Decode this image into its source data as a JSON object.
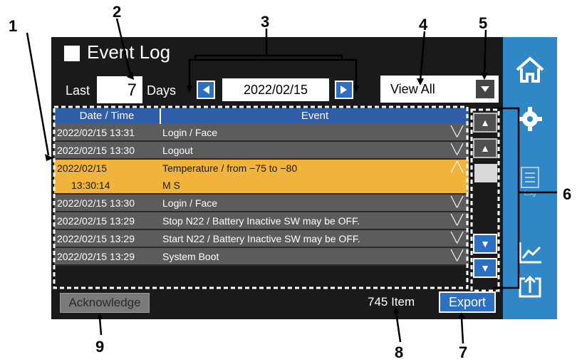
{
  "callouts": [
    "1",
    "2",
    "3",
    "4",
    "5",
    "6",
    "7",
    "8",
    "9"
  ],
  "title": "Event Log",
  "filter": {
    "last_label": "Last",
    "days_value": "7",
    "days_label": "Days",
    "date": "2022/02/15",
    "view_option": "View All"
  },
  "table": {
    "headers": [
      "Date / Time",
      "Event"
    ],
    "rows": [
      {
        "datetime": "2022/02/15 13:31",
        "event": "Login / Face"
      },
      {
        "datetime": "2022/02/15 13:30",
        "event": "Logout"
      },
      {
        "datetime": "2022/02/15",
        "event": "Temperature / from −75 to −80",
        "time": "13:30:14",
        "detail": "M S",
        "selected": true
      },
      {
        "datetime": "2022/02/15 13:30",
        "event": "Login / Face"
      },
      {
        "datetime": "2022/02/15 13:29",
        "event": "Stop N22 / Battery Inactive SW may be OFF."
      },
      {
        "datetime": "2022/02/15 13:29",
        "event": "Start N22 / Battery Inactive SW may be OFF."
      },
      {
        "datetime": "2022/02/15 13:29",
        "event": "System Boot"
      }
    ]
  },
  "footer": {
    "acknowledge_label": "Acknowledge",
    "count": "745",
    "count_unit": "Item",
    "export_label": "Export"
  },
  "sidebar": {
    "log_label": "Log"
  },
  "colors": {
    "accent": "#2f87c6",
    "selected_row": "#f0b43c",
    "row": "#5c5c5c",
    "header": "#2f5da8"
  }
}
